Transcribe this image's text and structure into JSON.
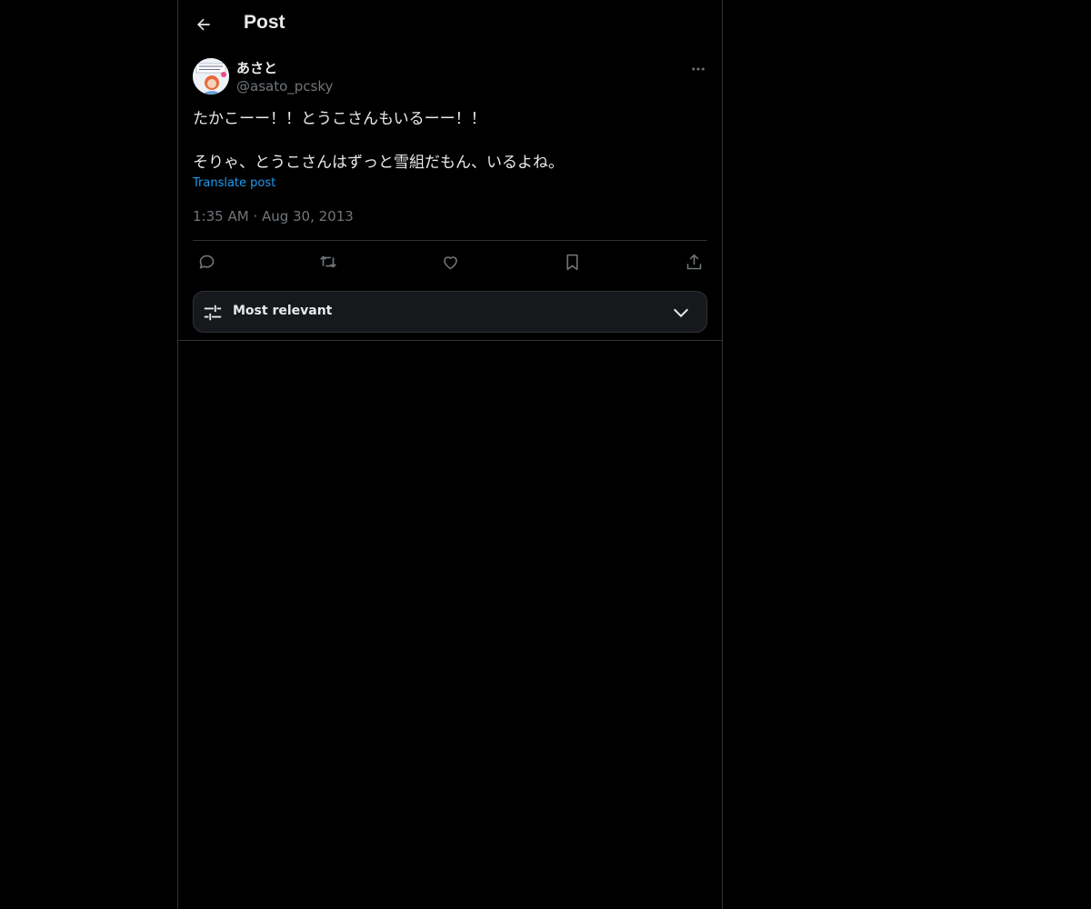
{
  "header": {
    "title": "Post"
  },
  "post": {
    "author": {
      "display_name": "あさと",
      "handle": "@asato_pcsky"
    },
    "text": "たかこーー！！とうこさんもいるーー！！\n\nそりゃ、とうこさんはずっと雪組だもん、いるよね。",
    "translate_label": "Translate post",
    "timestamp": "1:35 AM · Aug 30, 2013"
  },
  "actions": {
    "reply": "reply-icon",
    "repost": "repost-icon",
    "like": "heart-icon",
    "bookmark": "bookmark-icon",
    "share": "share-icon"
  },
  "replies_sort": {
    "label": "Most relevant"
  },
  "colors": {
    "background": "#000000",
    "text": "#e7e9ea",
    "secondary_text": "#71767b",
    "link": "#1d9bf0",
    "border": "#2f3336"
  }
}
